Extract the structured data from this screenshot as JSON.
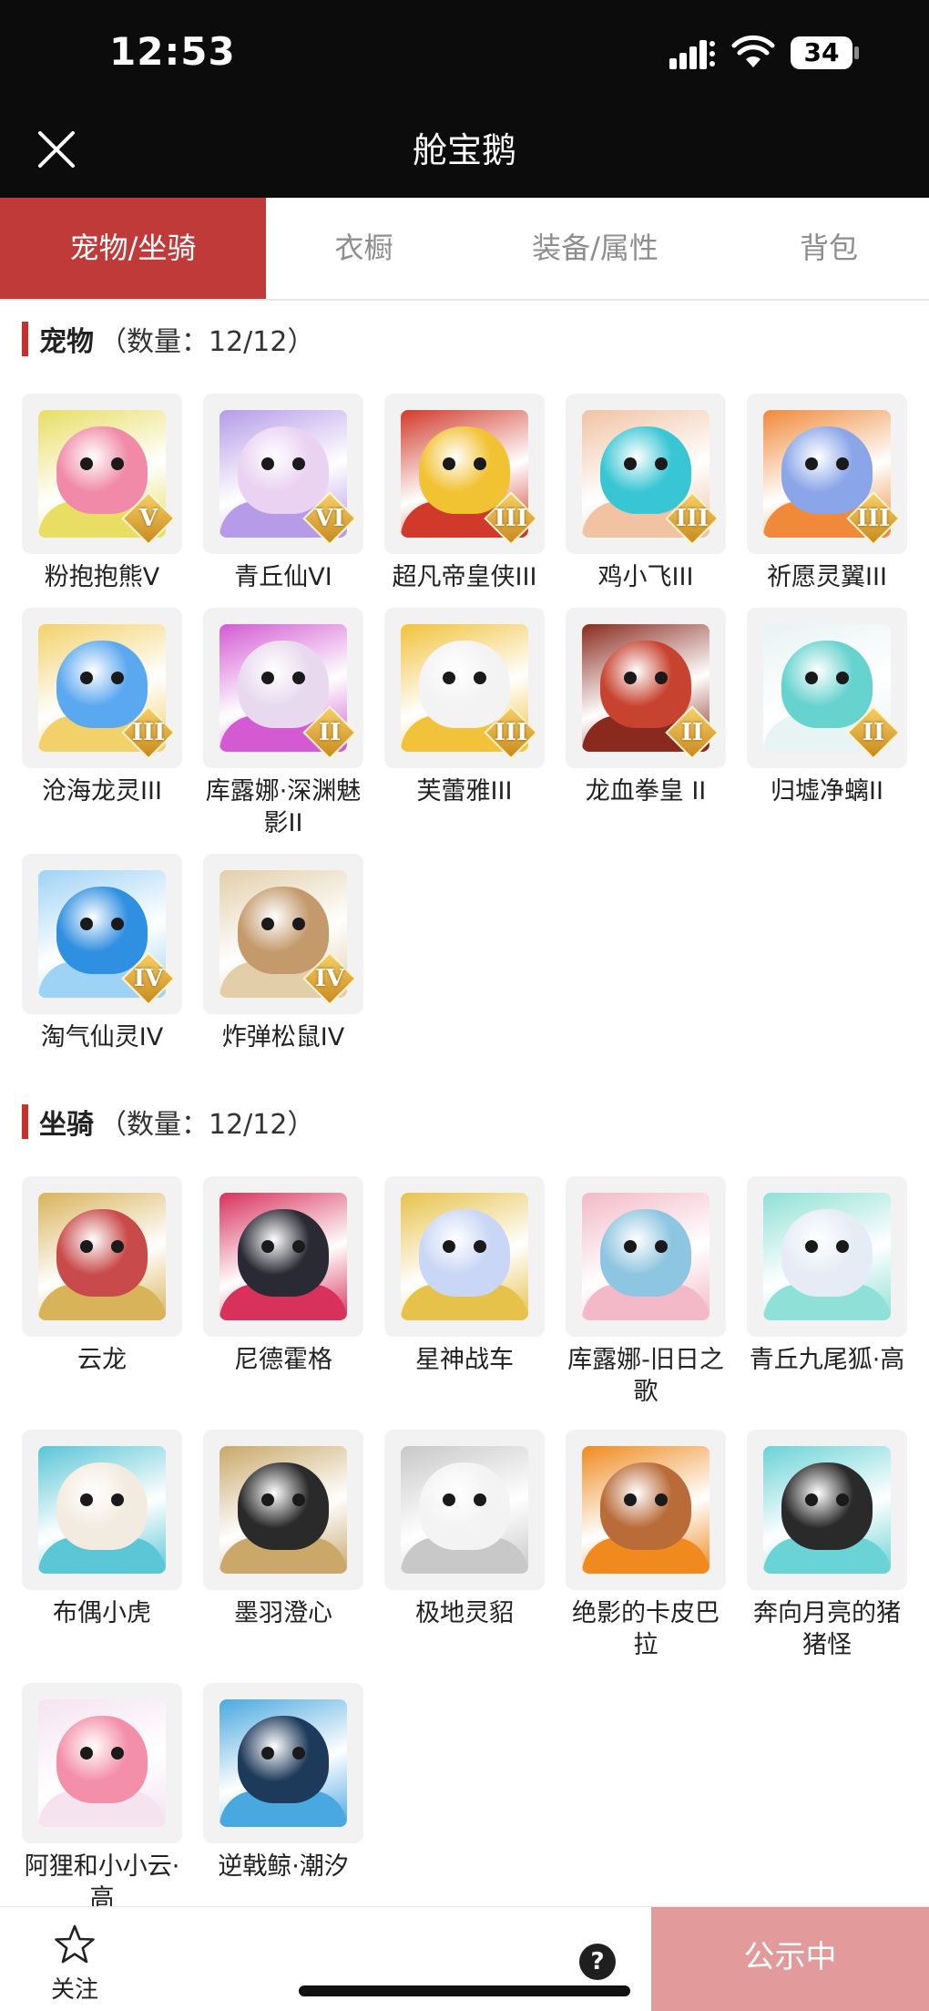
{
  "status_bar": {
    "time": "12:53",
    "battery": "34"
  },
  "nav": {
    "title": "舱宝鹅"
  },
  "tabs": [
    {
      "label": "宠物/坐骑",
      "active": true
    },
    {
      "label": "衣橱",
      "active": false
    },
    {
      "label": "装备/属性",
      "active": false
    },
    {
      "label": "背包",
      "active": false
    }
  ],
  "pets": {
    "title": "宠物",
    "count": "（数量：12/12）",
    "items": [
      {
        "name": "粉抱抱熊Ⅴ",
        "badge": "V",
        "palette": [
          "#f08aa8",
          "#e7de63"
        ],
        "icon": "bear-icon"
      },
      {
        "name": "青丘仙VI",
        "badge": "VI",
        "palette": [
          "#e9d2f2",
          "#b59be8"
        ],
        "icon": "fox-fairy-icon"
      },
      {
        "name": "超凡帝皇侠III",
        "badge": "III",
        "palette": [
          "#f1c232",
          "#d13a2a"
        ],
        "icon": "golden-warrior-icon"
      },
      {
        "name": "鸡小飞III",
        "badge": "III",
        "palette": [
          "#39c6d4",
          "#f1c3a3"
        ],
        "icon": "chick-icon"
      },
      {
        "name": "祈愿灵翼III",
        "badge": "III",
        "palette": [
          "#8aa6e8",
          "#f08a3a"
        ],
        "icon": "eagle-icon"
      },
      {
        "name": "沧海龙灵III",
        "badge": "III",
        "palette": [
          "#5aa8ef",
          "#f3d16a"
        ],
        "icon": "dragon-spirit-icon"
      },
      {
        "name": "库露娜·深渊魅影II",
        "badge": "II",
        "palette": [
          "#e8d9ee",
          "#d45ad4"
        ],
        "icon": "kuluna-icon"
      },
      {
        "name": "芙蕾雅III",
        "badge": "III",
        "palette": [
          "#f3f3f3",
          "#f2c23b"
        ],
        "icon": "freya-icon"
      },
      {
        "name": "龙血拳皇 II",
        "badge": "II",
        "palette": [
          "#c8432f",
          "#8a2a1e"
        ],
        "icon": "dragon-fist-icon"
      },
      {
        "name": "归墟净螭II",
        "badge": "II",
        "palette": [
          "#67d3cf",
          "#e8f3f3"
        ],
        "icon": "water-dragon-icon"
      },
      {
        "name": "淘气仙灵IV",
        "badge": "IV",
        "palette": [
          "#2f8fe0",
          "#9fd3f5"
        ],
        "icon": "blue-puppy-icon"
      },
      {
        "name": "炸弹松鼠IV",
        "badge": "IV",
        "palette": [
          "#c49a6c",
          "#e2cfaa"
        ],
        "icon": "squirrel-icon"
      }
    ]
  },
  "mounts": {
    "title": "坐骑",
    "count": "（数量：12/12）",
    "items": [
      {
        "name": "云龙",
        "palette": [
          "#c94a4a",
          "#d9b35a"
        ],
        "icon": "cloud-dragon-icon"
      },
      {
        "name": "尼德霍格",
        "palette": [
          "#2a2a35",
          "#d8315b"
        ],
        "icon": "nidhogg-icon"
      },
      {
        "name": "星神战车",
        "palette": [
          "#c9d6f5",
          "#e7c24a"
        ],
        "icon": "chariot-icon"
      },
      {
        "name": "库露娜-旧日之歌",
        "palette": [
          "#8ec5e0",
          "#f3b9c8"
        ],
        "icon": "kuluna-song-icon"
      },
      {
        "name": "青丘九尾狐·高",
        "palette": [
          "#e6ecf6",
          "#8fe0d6"
        ],
        "icon": "nine-tail-fox-icon"
      },
      {
        "name": "布偶小虎",
        "palette": [
          "#f3ebe0",
          "#5ac6d6"
        ],
        "icon": "plush-tiger-icon"
      },
      {
        "name": "墨羽澄心",
        "palette": [
          "#2a2a2a",
          "#c9a86a"
        ],
        "icon": "feather-staff-icon"
      },
      {
        "name": "极地灵貂",
        "palette": [
          "#f3f3f3",
          "#c8c8c8"
        ],
        "icon": "polar-marten-icon"
      },
      {
        "name": "绝影的卡皮巴拉",
        "palette": [
          "#b96b38",
          "#f08a1e"
        ],
        "icon": "capybara-icon"
      },
      {
        "name": "奔向月亮的猪猪怪",
        "palette": [
          "#2a2a2a",
          "#6ad3d6"
        ],
        "icon": "pig-monster-icon"
      },
      {
        "name": "阿狸和小小云·高",
        "palette": [
          "#f38fa8",
          "#f5e3f0"
        ],
        "icon": "ahri-cloud-icon"
      },
      {
        "name": "逆戟鲸·潮汐",
        "palette": [
          "#1e3a5a",
          "#4aa8e0"
        ],
        "icon": "orca-icon"
      }
    ]
  },
  "bottom": {
    "follow_label": "关注",
    "status_label": "公示中",
    "help": "?"
  }
}
